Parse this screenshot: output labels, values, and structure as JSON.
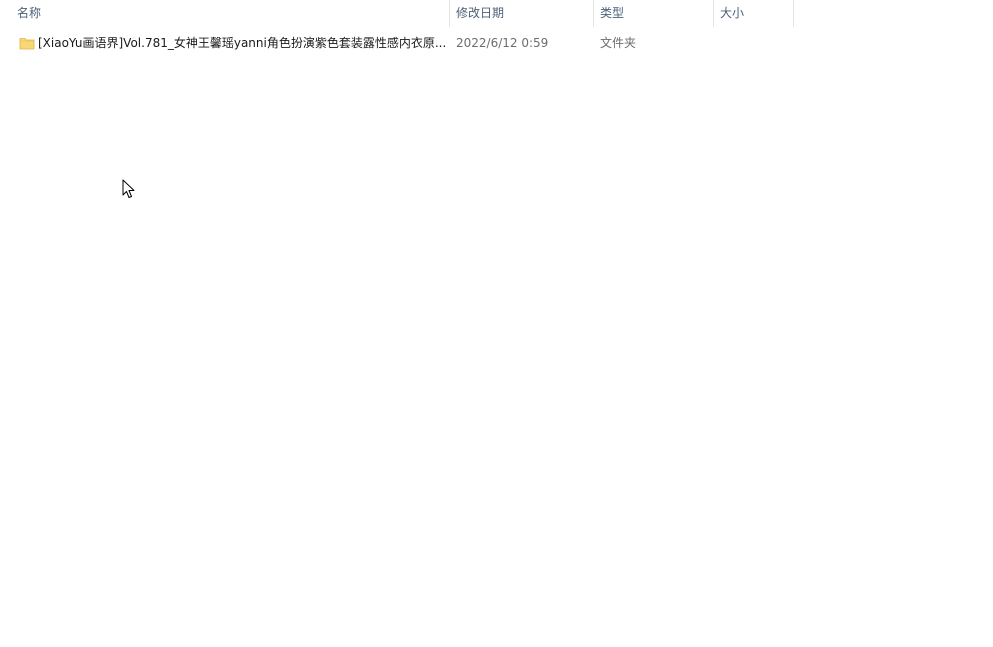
{
  "columns": {
    "name": "名称",
    "date_modified": "修改日期",
    "type": "类型",
    "size": "大小"
  },
  "sort": {
    "column": "name",
    "direction": "ascending",
    "icon": "chevron-up-icon"
  },
  "files": [
    {
      "icon": "folder-icon",
      "name": "[XiaoYu画语界]Vol.781_女神王馨瑶yanni角色扮演紫色套装露性感内衣原...",
      "date_modified": "2022/6/12 0:59",
      "type": "文件夹",
      "size": ""
    }
  ],
  "colors": {
    "header_text": "#4c607a",
    "folder_fill": "#f8d775",
    "folder_edge": "#e0b54a"
  }
}
